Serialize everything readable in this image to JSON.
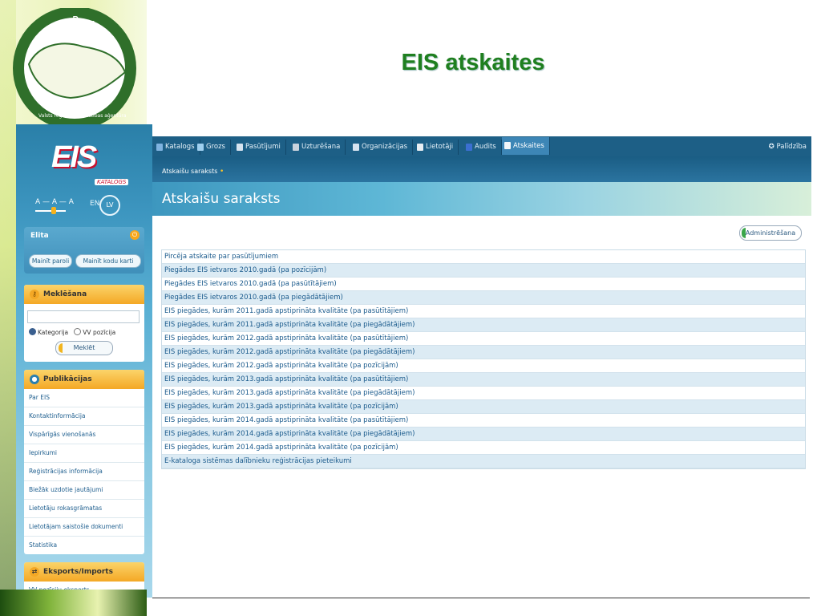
{
  "slide": {
    "title": "EIS atskaites"
  },
  "org_logo": {
    "letters": "VRAA",
    "caption": "Valsts reģionālās attīstības aģentūra"
  },
  "app": {
    "logo": {
      "text": "EIS",
      "tag": "KATALOGS"
    },
    "font_size_label": "A — A — A",
    "lang": {
      "en": "EN",
      "lv": "LV"
    },
    "user": {
      "name": "Elita",
      "change_password": "Mainīt paroli",
      "change_code_card": "Mainīt kodu karti"
    },
    "search": {
      "title": "Meklēšana",
      "input_value": "",
      "radio_category": "Kategorija",
      "radio_position": "VV pozīcija",
      "button": "Meklēt"
    },
    "publications": {
      "title": "Publikācijas",
      "items": [
        "Par EIS",
        "Kontaktinformācija",
        "Vispārīgās vienošanās",
        "Iepirkumi",
        "Reģistrācijas informācija",
        "Biežāk uzdotie jautājumi",
        "Lietotāju rokasgrāmatas",
        "Lietotājam saistošie dokumenti",
        "Statistika"
      ]
    },
    "export_import": {
      "title": "Eksports/Imports",
      "items": [
        "VV pozīciju eksports"
      ]
    },
    "nav": {
      "tabs": [
        "Katalogs",
        "Grozs",
        "Pasūtījumi",
        "Uzturēšana",
        "Organizācijas",
        "Lietotāji",
        "Audits",
        "Atskaites"
      ],
      "help": "Palīdzība"
    },
    "breadcrumb": "Atskaišu saraksts",
    "page_title": "Atskaišu saraksts",
    "admin_button": "Administrēšana",
    "reports": [
      "Pircēja atskaite par pasūtījumiem",
      "Piegādes EIS ietvaros 2010.gadā (pa pozīcijām)",
      "Piegādes EIS ietvaros 2010.gadā (pa pasūtītājiem)",
      "Piegādes EIS ietvaros 2010.gadā (pa piegādātājiem)",
      "EIS piegādes, kurām 2011.gadā apstiprināta kvalitāte (pa pasūtītājiem)",
      "EIS piegādes, kurām 2011.gadā apstiprināta kvalitāte (pa piegādātājiem)",
      "EIS piegādes, kurām 2012.gadā apstiprināta kvalitāte (pa pasūtītājiem)",
      "EIS piegādes, kurām 2012.gadā apstiprināta kvalitāte (pa piegādātājiem)",
      "EIS piegādes, kurām 2012.gadā apstiprināta kvalitāte (pa pozīcijām)",
      "EIS piegādes, kurām 2013.gadā apstiprināta kvalitāte (pa pasūtītājiem)",
      "EIS piegādes, kurām 2013.gadā apstiprināta kvalitāte (pa piegādātājiem)",
      "EIS piegādes, kurām 2013.gadā apstiprināta kvalitāte (pa pozīcijām)",
      "EIS piegādes, kurām 2014.gadā apstiprināta kvalitāte (pa pasūtītājiem)",
      "EIS piegādes, kurām 2014.gadā apstiprināta kvalitāte (pa piegādātājiem)",
      "EIS piegādes, kurām 2014.gadā apstiprināta kvalitāte (pa pozīcijām)",
      "E-kataloga sistēmas dalībnieku reģistrācijas pieteikumi"
    ],
    "colors": {
      "nav_bg": "#1d5f86",
      "link": "#1a5a8c",
      "accent": "#f4a825",
      "title_green": "#1f7f1f"
    }
  }
}
